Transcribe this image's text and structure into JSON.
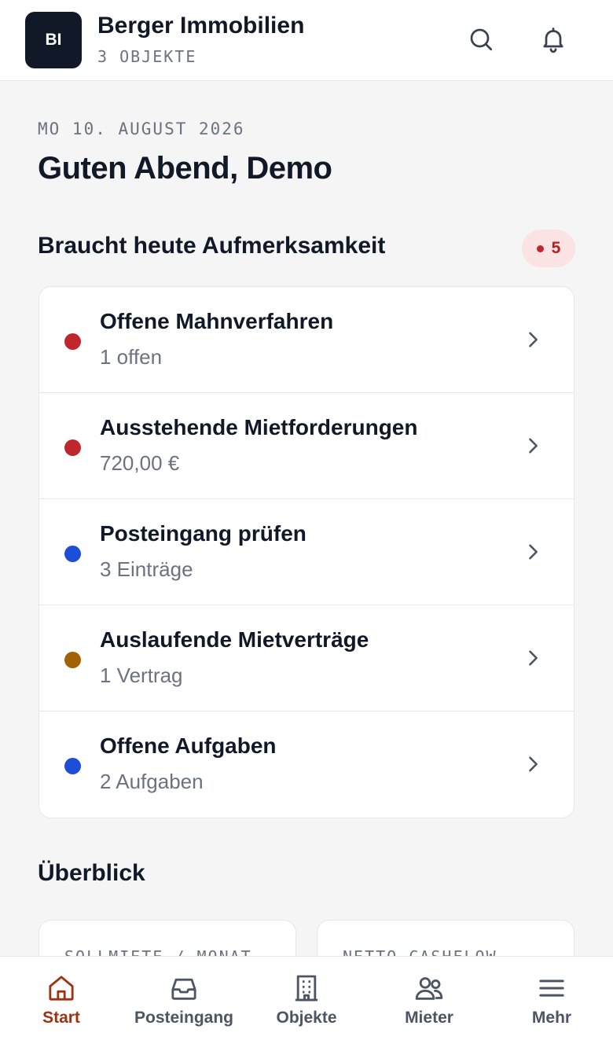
{
  "header": {
    "logo_initials": "BI",
    "company_name": "Berger Immobilien",
    "property_count": "3 OBJEKTE",
    "search_icon": "search-icon",
    "bell_icon": "bell-icon"
  },
  "main": {
    "date": "MO 10. AUGUST 2026",
    "greeting": "Guten Abend, Demo"
  },
  "attention": {
    "title": "Braucht heute Aufmerksamkeit",
    "count": "5",
    "items": [
      {
        "title": "Offene Mahnverfahren",
        "subtitle": "1 offen",
        "color": "#c0262d"
      },
      {
        "title": "Ausstehende Mietforderungen",
        "subtitle": "720,00 €",
        "color": "#c0262d"
      },
      {
        "title": "Posteingang prüfen",
        "subtitle": "3 Einträge",
        "color": "#1d4ed8"
      },
      {
        "title": "Auslaufende Mietverträge",
        "subtitle": "1 Vertrag",
        "color": "#a16207"
      },
      {
        "title": "Offene Aufgaben",
        "subtitle": "2 Aufgaben",
        "color": "#1d4ed8"
      }
    ]
  },
  "overview": {
    "title": "Überblick",
    "cards": [
      {
        "label": "SOLLMIETE / MONAT"
      },
      {
        "label": "NETTO-CASHFLOW"
      }
    ]
  },
  "tabbar": {
    "tabs": [
      {
        "label": "Start",
        "icon": "home-icon",
        "active": true
      },
      {
        "label": "Posteingang",
        "icon": "inbox-icon",
        "active": false
      },
      {
        "label": "Objekte",
        "icon": "building-icon",
        "active": false
      },
      {
        "label": "Mieter",
        "icon": "users-icon",
        "active": false
      },
      {
        "label": "Mehr",
        "icon": "menu-icon",
        "active": false
      }
    ]
  },
  "colors": {
    "accent": "#9a3412",
    "danger": "#c0262d",
    "info": "#1d4ed8",
    "warning": "#a16207"
  }
}
